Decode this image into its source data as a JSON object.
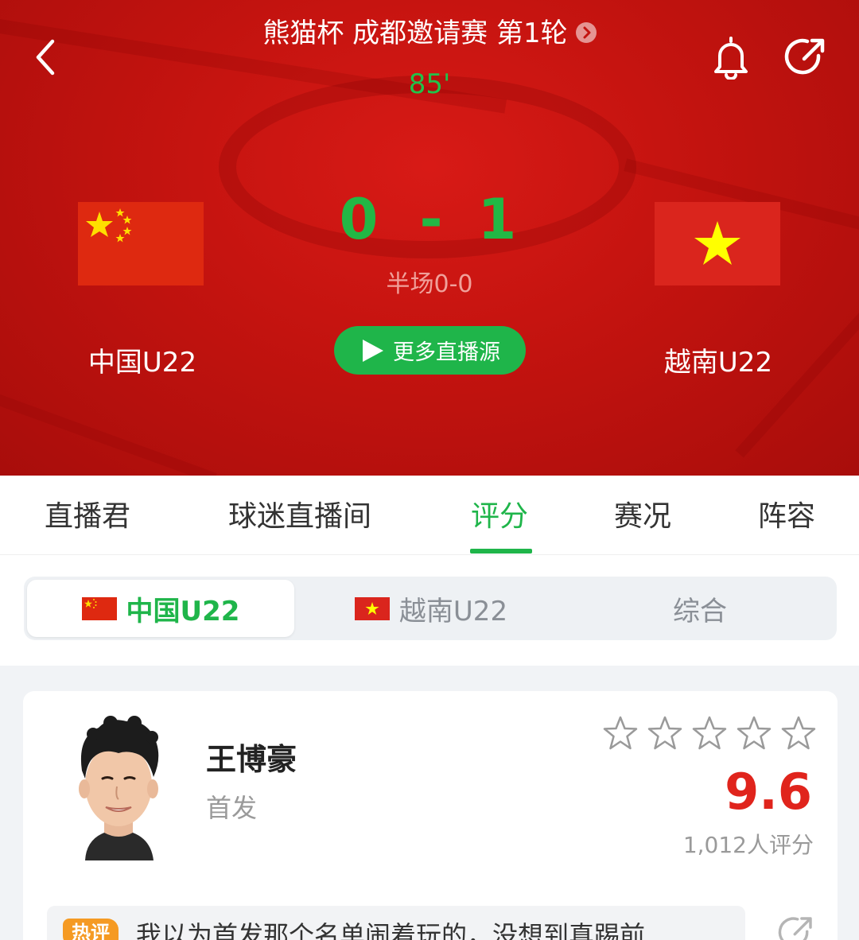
{
  "header": {
    "title": "熊猫杯 成都邀请赛 第1轮",
    "minute": "85'",
    "home_team": "中国U22",
    "away_team": "越南U22",
    "home_score": "0",
    "separator": "-",
    "away_score": "1",
    "halftime": "半场0-0",
    "live_button": "更多直播源"
  },
  "tabs": [
    {
      "label": "直播君"
    },
    {
      "label": "球迷直播间"
    },
    {
      "label": "评分",
      "active": true
    },
    {
      "label": "赛况"
    },
    {
      "label": "阵容"
    }
  ],
  "team_switch": [
    {
      "label": "中国U22",
      "active": true
    },
    {
      "label": "越南U22"
    },
    {
      "label": "综合"
    }
  ],
  "player_card": {
    "name": "王博豪",
    "role": "首发",
    "rating": "9.6",
    "rating_count": "1,012人评分",
    "stars_filled": 0,
    "stars_total": 5,
    "hot_badge": "热评",
    "hot_comment": "我以为首发那个名单闹着玩的，没想到真踢前..."
  },
  "colors": {
    "banner_red": "#c3130f",
    "accent_green": "#1fb54a",
    "rating_red": "#e0241c",
    "hot_orange": "#f59a23"
  }
}
